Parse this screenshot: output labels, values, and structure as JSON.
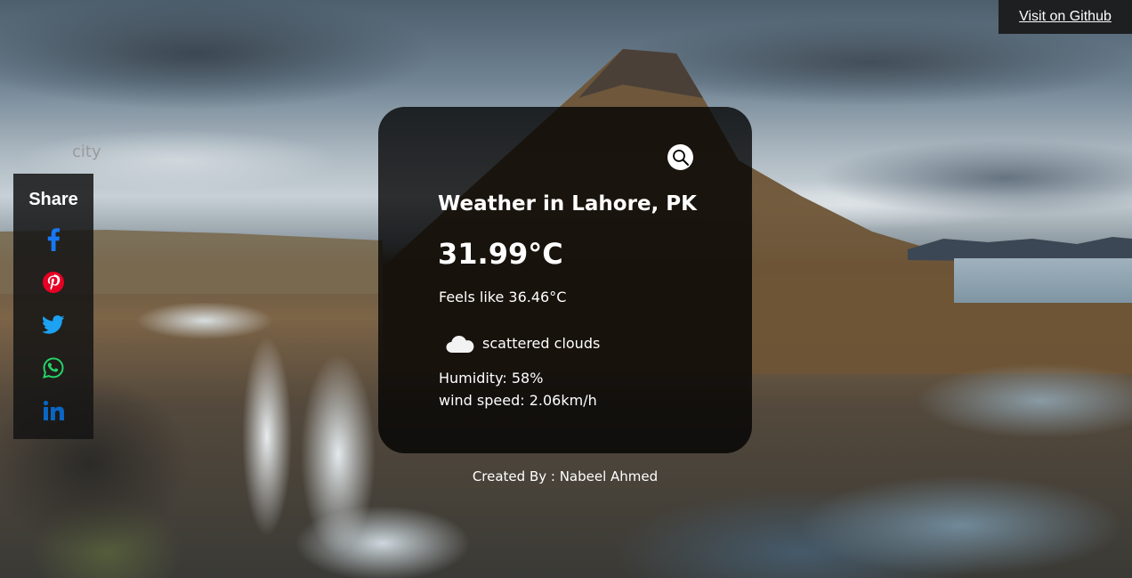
{
  "github": {
    "link_label": "Visit on Github"
  },
  "share": {
    "title": "Share",
    "icons": [
      {
        "name": "facebook-icon",
        "color": "#1877f2"
      },
      {
        "name": "pinterest-icon",
        "color": "#e60023"
      },
      {
        "name": "twitter-icon",
        "color": "#1da1f2"
      },
      {
        "name": "whatsapp-icon",
        "color": "#25d366"
      },
      {
        "name": "linkedin-icon",
        "color": "#0a66c2"
      }
    ]
  },
  "search": {
    "placeholder": "city",
    "value": ""
  },
  "weather": {
    "title": "Weather in Lahore, PK",
    "temperature": "31.99°C",
    "feels_like": "Feels like 36.46°C",
    "icon": "cloud-icon",
    "description": "scattered clouds",
    "humidity": "Humidity: 58%",
    "wind_speed": "wind speed: 2.06km/h"
  },
  "footer": {
    "credit": "Created By : Nabeel Ahmed"
  }
}
